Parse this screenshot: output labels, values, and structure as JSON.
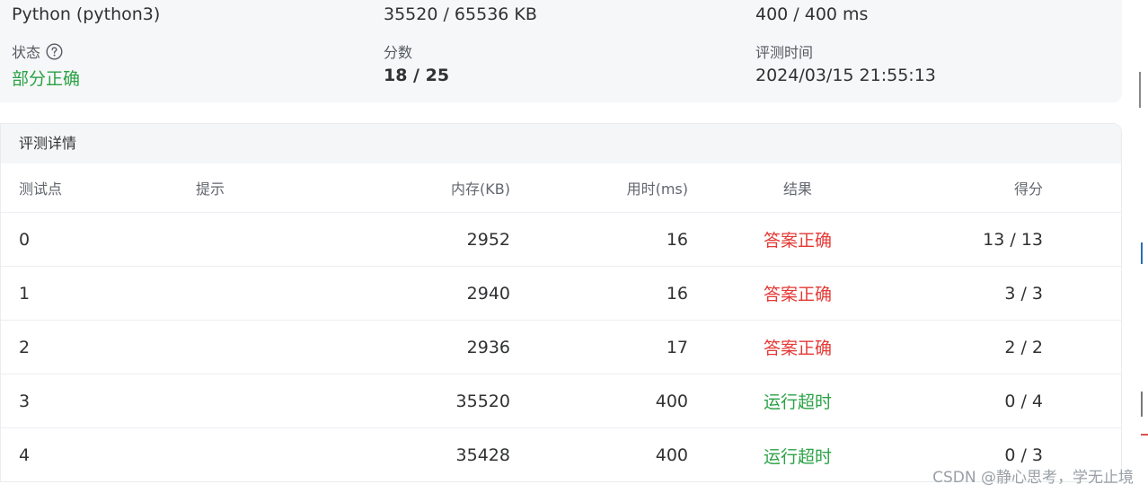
{
  "summary": {
    "language": "Python (python3)",
    "memory": "35520 / 65536 KB",
    "time": "400 / 400 ms",
    "status_label": "状态",
    "status_value": "部分正确",
    "score_label": "分数",
    "score_value": "18 / 25",
    "judge_time_label": "评测时间",
    "judge_time_value": "2024/03/15 21:55:13"
  },
  "details": {
    "title": "评测详情",
    "columns": {
      "case": "测试点",
      "hint": "提示",
      "memory": "内存(KB)",
      "time": "用时(ms)",
      "result": "结果",
      "score": "得分"
    },
    "rows": [
      {
        "case": "0",
        "hint": "",
        "memory": "2952",
        "time": "16",
        "result": "答案正确",
        "score": "13 / 13"
      },
      {
        "case": "1",
        "hint": "",
        "memory": "2940",
        "time": "16",
        "result": "答案正确",
        "score": "3 / 3"
      },
      {
        "case": "2",
        "hint": "",
        "memory": "2936",
        "time": "17",
        "result": "答案正确",
        "score": "2 / 2"
      },
      {
        "case": "3",
        "hint": "",
        "memory": "35520",
        "time": "400",
        "result": "运行超时",
        "score": "0 / 4"
      },
      {
        "case": "4",
        "hint": "",
        "memory": "35428",
        "time": "400",
        "result": "运行超时",
        "score": "0 / 3"
      }
    ]
  },
  "colors": {
    "accepted": "#e53935",
    "time_limit": "#2ba245",
    "partial": "#2ba245"
  },
  "icons": {
    "status_help": "question-circle-icon"
  },
  "watermark": "CSDN @静心思考，学无止境"
}
